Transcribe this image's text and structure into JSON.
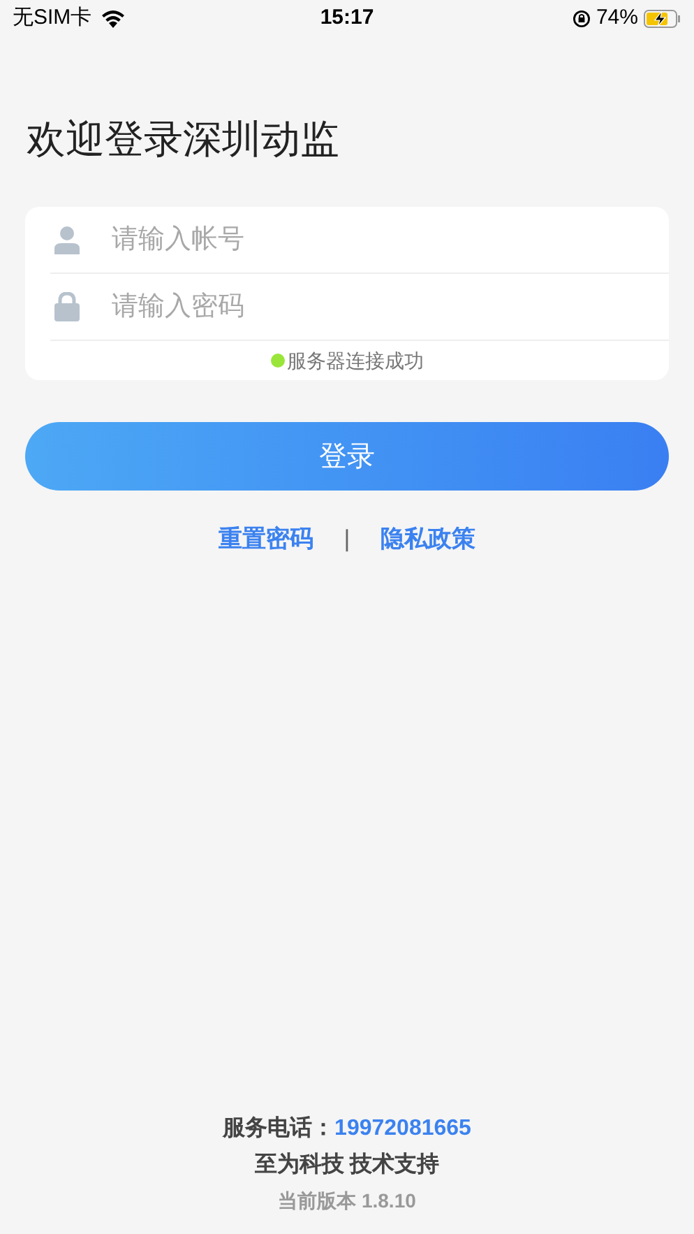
{
  "status_bar": {
    "carrier": "无SIM卡",
    "time": "15:17",
    "battery": "74%"
  },
  "title": "欢迎登录深圳动监",
  "fields": [
    {
      "kind": "user",
      "placeholder": "请输入帐号"
    },
    {
      "kind": "lock",
      "placeholder": "请输入密码"
    }
  ],
  "server_status": {
    "text": "服务器连接成功",
    "connected": true
  },
  "login_button": "登录",
  "links": [
    "重置密码",
    "隐私政策"
  ],
  "separator": "|",
  "footer": {
    "phone_label": "服务电话：",
    "phone": "19972081665",
    "support": "至为科技 技术支持",
    "version": "当前版本 1.8.10"
  }
}
